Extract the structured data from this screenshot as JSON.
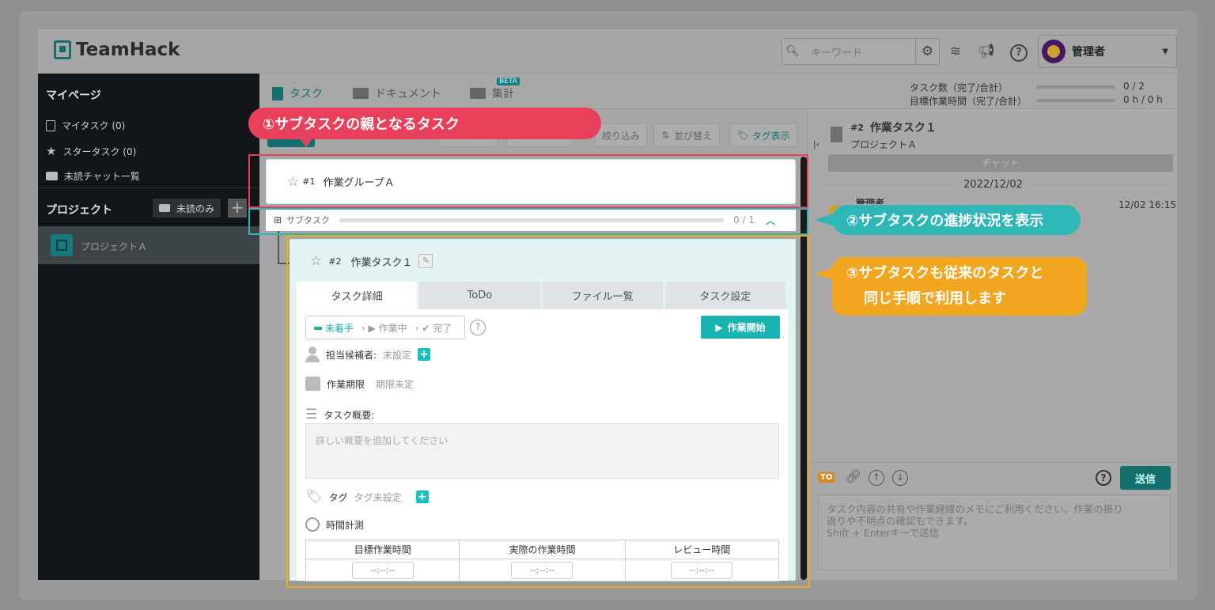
{
  "app": {
    "logo_text": "TeamHack"
  },
  "header": {
    "search_placeholder": "キーワード",
    "user_name": "管理者",
    "icons": [
      "search-icon",
      "gear-icon",
      "layers-icon",
      "megaphone-icon",
      "help-icon",
      "chevron-down-icon"
    ]
  },
  "sidebar": {
    "mypage_title": "マイページ",
    "items": [
      {
        "label": "マイタスク (0)",
        "icon": "document-icon"
      },
      {
        "label": "スタータスク (0)",
        "icon": "star-icon"
      },
      {
        "label": "未読チャット一覧",
        "icon": "chat-icon"
      }
    ],
    "project_title": "プロジェクト",
    "unread_only": "未読のみ",
    "project_name": "プロジェクトＡ"
  },
  "tabs": {
    "task": "タスク",
    "document": "ドキュメント",
    "summary": "集計",
    "beta": "BETA"
  },
  "stats": {
    "task_count_label": "タスク数（完了/合計）",
    "task_count_value": "0 / 2",
    "target_time_label": "目標作業時間（完了/合計）",
    "target_time_value": "0 h / 0 h"
  },
  "toolbar": {
    "filter": "絞り込み",
    "sort": "並び替え",
    "tag_display": "タグ表示"
  },
  "parent_task": {
    "number": "#1",
    "title": "作業グループＡ"
  },
  "subtask_row": {
    "label": "サブタスク",
    "progress_text": "0 / 1",
    "progress": 0
  },
  "subtask": {
    "number": "#2",
    "title": "作業タスク１",
    "tabs": [
      "タスク詳細",
      "ToDo",
      "ファイル一覧",
      "タスク設定"
    ],
    "status": [
      "未着手",
      "作業中",
      "完了"
    ],
    "start_button": "作業開始",
    "assignee_label": "担当候補者:",
    "assignee_value": "未設定",
    "deadline_label": "作業期限",
    "deadline_value": "期限未定",
    "summary_label": "タスク概要:",
    "summary_placeholder": "詳しい概要を追加してください",
    "tag_label": "タグ",
    "tag_value": "タグ未設定",
    "time_label": "時間計測",
    "time_headers": [
      "目標作業時間",
      "実際の作業時間",
      "レビュー時間"
    ],
    "time_values": [
      "--:--:--",
      "--:--:--",
      "--:--:--"
    ]
  },
  "chat": {
    "task_number": "#2",
    "task_title": "作業タスク１",
    "project": "プロジェクトＡ",
    "chat_tab": "チャット",
    "date_separator": "2022/12/02",
    "message_author": "管理者",
    "message_time": "12/02 16:15",
    "to_badge": "TO",
    "send_button": "送信",
    "input_placeholder_lines": [
      "タスク内容の共有や作業経緯のメモにご利用ください。作業の振り",
      "返りや不明点の確認もできます。",
      "Shift + Enterキーで送信"
    ]
  },
  "callouts": {
    "c1": "①サブタスクの親となるタスク",
    "c2": "②サブタスクの進捗状況を表示",
    "c3_line1": "③サブタスクも従来のタスクと",
    "c3_line2": "同じ手順で利用します"
  },
  "colors": {
    "red": "#e8405a",
    "teal": "#2fb6b7",
    "orange": "#f2a51f",
    "accent": "#19b3b1"
  }
}
